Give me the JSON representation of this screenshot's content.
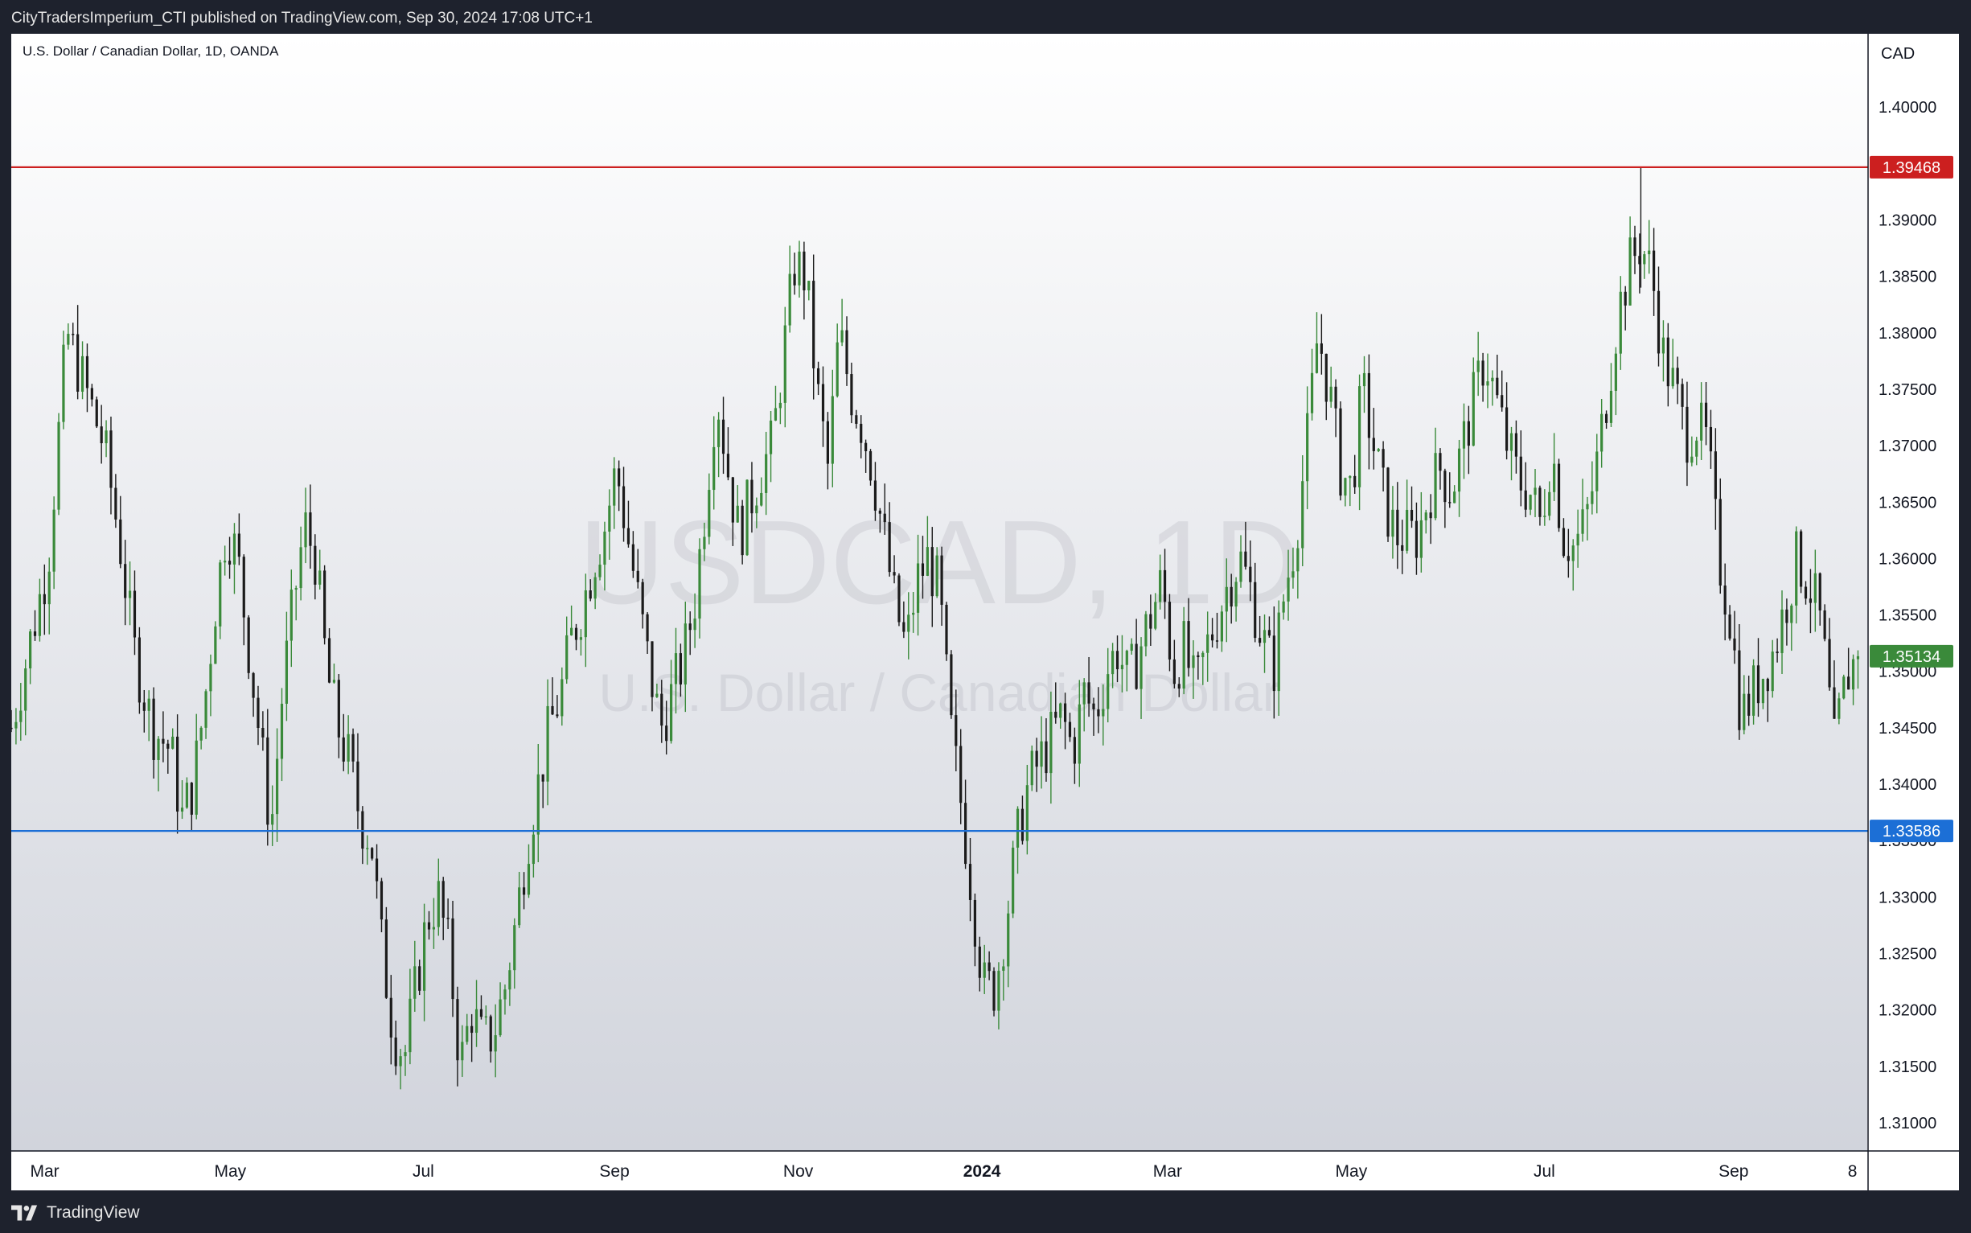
{
  "header": {
    "publish_line": "CityTradersImperium_CTI published on TradingView.com, Sep 30, 2024 17:08 UTC+1"
  },
  "chart_header": {
    "symbol_line": "U.S. Dollar / Canadian Dollar, 1D, OANDA",
    "currency": "CAD"
  },
  "watermark": {
    "symbol": "USDCAD, 1D",
    "name": "U.S. Dollar / Canadian Dollar"
  },
  "footer": {
    "brand": "TradingView"
  },
  "colors": {
    "up": "#3a8a3a",
    "down": "#1b1b1b",
    "resistance": "#cc1f1f",
    "support": "#1c6fd6",
    "last_price": "#3a8a3a"
  },
  "chart_data": {
    "type": "candlestick",
    "ylim": [
      1.3075,
      1.4065
    ],
    "y_ticks": [
      "1.31000",
      "1.31500",
      "1.32000",
      "1.32500",
      "1.33000",
      "1.33500",
      "1.34000",
      "1.34500",
      "1.35000",
      "1.35500",
      "1.36000",
      "1.36500",
      "1.37000",
      "1.37500",
      "1.38000",
      "1.38500",
      "1.39000",
      "1.40000"
    ],
    "x_labels": [
      {
        "label": "Mar",
        "pos": 0.018
      },
      {
        "label": "May",
        "pos": 0.118
      },
      {
        "label": "Jul",
        "pos": 0.222
      },
      {
        "label": "Sep",
        "pos": 0.325
      },
      {
        "label": "Nov",
        "pos": 0.424
      },
      {
        "label": "2024",
        "pos": 0.523,
        "bold": true
      },
      {
        "label": "Mar",
        "pos": 0.623
      },
      {
        "label": "May",
        "pos": 0.722
      },
      {
        "label": "Jul",
        "pos": 0.826
      },
      {
        "label": "Sep",
        "pos": 0.928
      },
      {
        "label": "8",
        "pos": 0.992
      }
    ],
    "horizontal_lines": [
      {
        "name": "resistance",
        "value": 1.39468,
        "label": "1.39468"
      },
      {
        "name": "support",
        "value": 1.33586,
        "label": "1.33586"
      }
    ],
    "last_price": {
      "value": 1.35134,
      "label": "1.35134"
    },
    "closes": [
      [
        0.0,
        1.345
      ],
      [
        0.02,
        1.36
      ],
      [
        0.03,
        1.38
      ],
      [
        0.04,
        1.375
      ],
      [
        0.05,
        1.37
      ],
      [
        0.058,
        1.362
      ],
      [
        0.066,
        1.352
      ],
      [
        0.076,
        1.345
      ],
      [
        0.086,
        1.343
      ],
      [
        0.092,
        1.337
      ],
      [
        0.098,
        1.34
      ],
      [
        0.104,
        1.347
      ],
      [
        0.11,
        1.356
      ],
      [
        0.116,
        1.363
      ],
      [
        0.122,
        1.36
      ],
      [
        0.128,
        1.352
      ],
      [
        0.134,
        1.344
      ],
      [
        0.14,
        1.336
      ],
      [
        0.146,
        1.348
      ],
      [
        0.152,
        1.356
      ],
      [
        0.158,
        1.363
      ],
      [
        0.164,
        1.36
      ],
      [
        0.17,
        1.35
      ],
      [
        0.176,
        1.345
      ],
      [
        0.182,
        1.342
      ],
      [
        0.188,
        1.337
      ],
      [
        0.194,
        1.335
      ],
      [
        0.2,
        1.325
      ],
      [
        0.206,
        1.318
      ],
      [
        0.212,
        1.316
      ],
      [
        0.218,
        1.322
      ],
      [
        0.224,
        1.328
      ],
      [
        0.23,
        1.33
      ],
      [
        0.236,
        1.325
      ],
      [
        0.242,
        1.315
      ],
      [
        0.248,
        1.32
      ],
      [
        0.254,
        1.317
      ],
      [
        0.26,
        1.318
      ],
      [
        0.266,
        1.322
      ],
      [
        0.272,
        1.328
      ],
      [
        0.278,
        1.335
      ],
      [
        0.284,
        1.34
      ],
      [
        0.29,
        1.345
      ],
      [
        0.296,
        1.348
      ],
      [
        0.302,
        1.353
      ],
      [
        0.308,
        1.356
      ],
      [
        0.314,
        1.36
      ],
      [
        0.32,
        1.363
      ],
      [
        0.326,
        1.368
      ],
      [
        0.332,
        1.362
      ],
      [
        0.338,
        1.356
      ],
      [
        0.344,
        1.35
      ],
      [
        0.35,
        1.345
      ],
      [
        0.356,
        1.348
      ],
      [
        0.362,
        1.351
      ],
      [
        0.368,
        1.356
      ],
      [
        0.374,
        1.365
      ],
      [
        0.38,
        1.375
      ],
      [
        0.386,
        1.368
      ],
      [
        0.392,
        1.362
      ],
      [
        0.398,
        1.365
      ],
      [
        0.404,
        1.368
      ],
      [
        0.41,
        1.37
      ],
      [
        0.416,
        1.378
      ],
      [
        0.422,
        1.386
      ],
      [
        0.428,
        1.385
      ],
      [
        0.434,
        1.375
      ],
      [
        0.44,
        1.368
      ],
      [
        0.446,
        1.38
      ],
      [
        0.452,
        1.375
      ],
      [
        0.458,
        1.372
      ],
      [
        0.464,
        1.368
      ],
      [
        0.47,
        1.362
      ],
      [
        0.476,
        1.356
      ],
      [
        0.482,
        1.352
      ],
      [
        0.488,
        1.358
      ],
      [
        0.494,
        1.36
      ],
      [
        0.5,
        1.357
      ],
      [
        0.506,
        1.345
      ],
      [
        0.512,
        1.338
      ],
      [
        0.518,
        1.33
      ],
      [
        0.524,
        1.322
      ],
      [
        0.53,
        1.322
      ],
      [
        0.536,
        1.328
      ],
      [
        0.542,
        1.335
      ],
      [
        0.548,
        1.34
      ],
      [
        0.554,
        1.342
      ],
      [
        0.56,
        1.344
      ],
      [
        0.566,
        1.346
      ],
      [
        0.572,
        1.343
      ],
      [
        0.578,
        1.348
      ],
      [
        0.584,
        1.346
      ],
      [
        0.59,
        1.35
      ],
      [
        0.596,
        1.352
      ],
      [
        0.602,
        1.349
      ],
      [
        0.608,
        1.352
      ],
      [
        0.614,
        1.355
      ],
      [
        0.62,
        1.358
      ],
      [
        0.626,
        1.35
      ],
      [
        0.632,
        1.352
      ],
      [
        0.638,
        1.348
      ],
      [
        0.644,
        1.352
      ],
      [
        0.65,
        1.355
      ],
      [
        0.656,
        1.358
      ],
      [
        0.662,
        1.36
      ],
      [
        0.668,
        1.357
      ],
      [
        0.674,
        1.353
      ],
      [
        0.68,
        1.35
      ],
      [
        0.686,
        1.357
      ],
      [
        0.692,
        1.362
      ],
      [
        0.698,
        1.37
      ],
      [
        0.704,
        1.38
      ],
      [
        0.71,
        1.375
      ],
      [
        0.716,
        1.368
      ],
      [
        0.722,
        1.366
      ],
      [
        0.728,
        1.375
      ],
      [
        0.734,
        1.37
      ],
      [
        0.74,
        1.365
      ],
      [
        0.746,
        1.362
      ],
      [
        0.752,
        1.362
      ],
      [
        0.758,
        1.362
      ],
      [
        0.764,
        1.366
      ],
      [
        0.77,
        1.368
      ],
      [
        0.776,
        1.366
      ],
      [
        0.782,
        1.37
      ],
      [
        0.788,
        1.374
      ],
      [
        0.794,
        1.378
      ],
      [
        0.8,
        1.374
      ],
      [
        0.806,
        1.37
      ],
      [
        0.812,
        1.367
      ],
      [
        0.818,
        1.366
      ],
      [
        0.824,
        1.363
      ],
      [
        0.83,
        1.37
      ],
      [
        0.836,
        1.362
      ],
      [
        0.842,
        1.361
      ],
      [
        0.848,
        1.363
      ],
      [
        0.854,
        1.368
      ],
      [
        0.86,
        1.375
      ],
      [
        0.866,
        1.382
      ],
      [
        0.872,
        1.386
      ],
      [
        0.878,
        1.388
      ],
      [
        0.884,
        1.385
      ],
      [
        0.89,
        1.378
      ],
      [
        0.896,
        1.375
      ],
      [
        0.902,
        1.371
      ],
      [
        0.908,
        1.372
      ],
      [
        0.914,
        1.37
      ],
      [
        0.92,
        1.36
      ],
      [
        0.926,
        1.355
      ],
      [
        0.932,
        1.346
      ],
      [
        0.938,
        1.348
      ],
      [
        0.944,
        1.35
      ],
      [
        0.95,
        1.352
      ],
      [
        0.956,
        1.356
      ],
      [
        0.962,
        1.36
      ],
      [
        0.968,
        1.358
      ],
      [
        0.974,
        1.355
      ],
      [
        0.978,
        1.35
      ],
      [
        0.982,
        1.343
      ],
      [
        0.986,
        1.347
      ],
      [
        0.99,
        1.35
      ],
      [
        0.995,
        1.3513
      ]
    ]
  }
}
